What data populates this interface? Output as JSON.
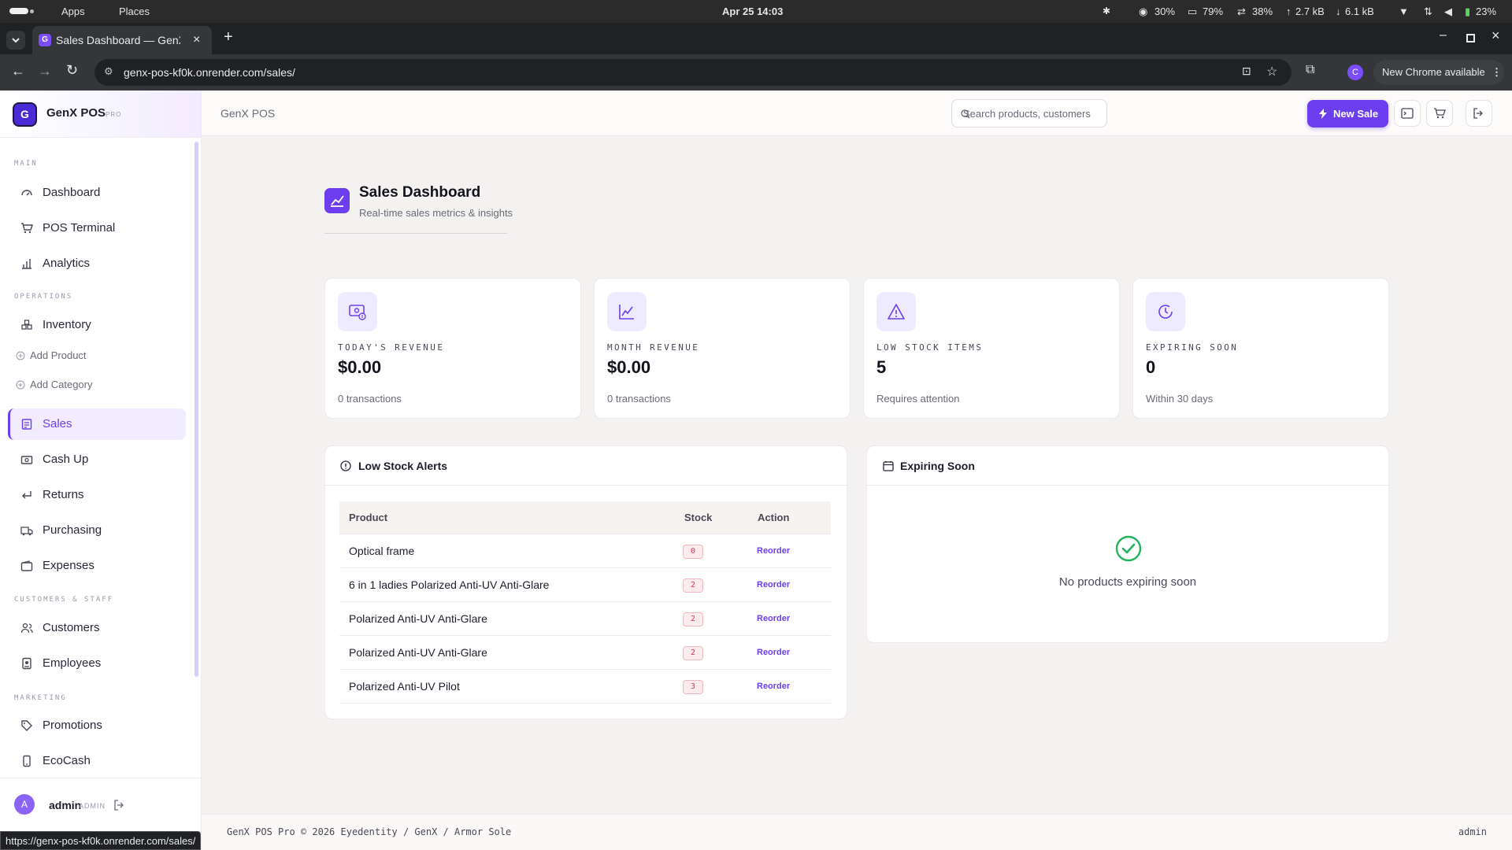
{
  "os": {
    "apps": "Apps",
    "places": "Places",
    "clock": "Apr 25  14:03",
    "stats": [
      "30%",
      "79%",
      "38%",
      "2.7 kB",
      "6.1 kB"
    ],
    "battery": "23%"
  },
  "browser": {
    "tab_title": "Sales Dashboard — GenX",
    "url": "genx-pos-kf0k.onrender.com/sales/",
    "update_label": "New Chrome available",
    "profile_initial": "C",
    "status_url": "https://genx-pos-kf0k.onrender.com/sales/"
  },
  "brand": {
    "logo_letter": "G",
    "name": "GenX POS",
    "tier": "PRO"
  },
  "sidebar": {
    "sections": {
      "main": "MAIN",
      "operations": "OPERATIONS",
      "customers_staff": "CUSTOMERS & STAFF",
      "marketing": "MARKETING"
    },
    "items": {
      "dashboard": "Dashboard",
      "pos_terminal": "POS Terminal",
      "analytics": "Analytics",
      "inventory": "Inventory",
      "add_product": "Add Product",
      "add_category": "Add Category",
      "sales": "Sales",
      "cash_up": "Cash Up",
      "returns": "Returns",
      "purchasing": "Purchasing",
      "expenses": "Expenses",
      "customers": "Customers",
      "employees": "Employees",
      "promotions": "Promotions",
      "ecocash": "EcoCash"
    },
    "active": "sales",
    "user": {
      "initial": "A",
      "name": "admin",
      "role": "ADMIN"
    }
  },
  "topbar": {
    "breadcrumb": "GenX POS",
    "search_placeholder": "Search products, customers",
    "new_sale_label": "New Sale"
  },
  "header": {
    "title": "Sales Dashboard",
    "subtitle": "Real-time sales metrics & insights"
  },
  "kpis": [
    {
      "label": "TODAY'S REVENUE",
      "value": "$0.00",
      "sub": "0 transactions"
    },
    {
      "label": "MONTH REVENUE",
      "value": "$0.00",
      "sub": "0 transactions"
    },
    {
      "label": "LOW STOCK ITEMS",
      "value": "5",
      "sub": "Requires attention"
    },
    {
      "label": "EXPIRING SOON",
      "value": "0",
      "sub": "Within 30 days"
    }
  ],
  "low_stock": {
    "title": "Low Stock Alerts",
    "columns": [
      "Product",
      "Stock",
      "Action"
    ],
    "rows": [
      {
        "product": "Optical frame",
        "stock": "0",
        "action": "Reorder"
      },
      {
        "product": "6 in 1 ladies Polarized Anti-UV Anti-Glare",
        "stock": "2",
        "action": "Reorder"
      },
      {
        "product": "Polarized Anti-UV Anti-Glare",
        "stock": "2",
        "action": "Reorder"
      },
      {
        "product": "Polarized Anti-UV Anti-Glare",
        "stock": "2",
        "action": "Reorder"
      },
      {
        "product": "Polarized Anti-UV Pilot",
        "stock": "3",
        "action": "Reorder"
      }
    ]
  },
  "expiring": {
    "title": "Expiring Soon",
    "empty_message": "No products expiring soon"
  },
  "footer": {
    "left": "GenX POS Pro © 2026 Eyedentity / GenX / Armor Sole",
    "right": "admin"
  },
  "colors": {
    "accent": "#6d3ef0",
    "danger": "#d63a58",
    "success": "#22b35e"
  }
}
